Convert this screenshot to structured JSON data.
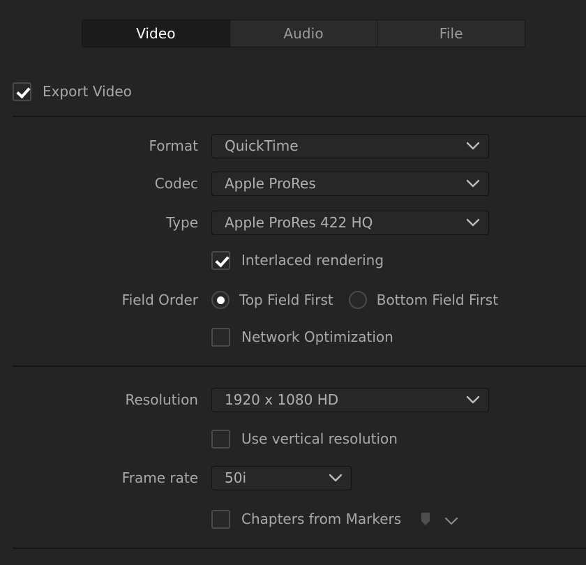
{
  "tabs": [
    {
      "id": "video",
      "label": "Video",
      "active": true
    },
    {
      "id": "audio",
      "label": "Audio",
      "active": false
    },
    {
      "id": "file",
      "label": "File",
      "active": false
    }
  ],
  "export_video": {
    "label": "Export Video",
    "checked": true
  },
  "video_section": {
    "format": {
      "label": "Format",
      "value": "QuickTime"
    },
    "codec": {
      "label": "Codec",
      "value": "Apple ProRes"
    },
    "type": {
      "label": "Type",
      "value": "Apple ProRes 422 HQ"
    },
    "interlaced": {
      "label": "Interlaced rendering",
      "checked": true
    },
    "field_order": {
      "label": "Field Order",
      "options": [
        {
          "label": "Top Field First",
          "selected": true
        },
        {
          "label": "Bottom Field First",
          "selected": false
        }
      ]
    },
    "network_optimization": {
      "label": "Network Optimization",
      "checked": false
    }
  },
  "resolution_section": {
    "resolution": {
      "label": "Resolution",
      "value": "1920 x 1080 HD"
    },
    "use_vertical": {
      "label": "Use vertical resolution",
      "checked": false
    },
    "frame_rate": {
      "label": "Frame rate",
      "value": "50i"
    },
    "chapters": {
      "label": "Chapters from Markers",
      "checked": false
    }
  },
  "icons": {
    "chevron_down": "chevron-down-icon",
    "marker": "marker-flag-icon",
    "checkmark": "check-icon"
  },
  "colors": {
    "background": "#242424",
    "panel_control": "#272727",
    "tab_active": "#1b1b1b",
    "tab_inactive": "#2b2b2b",
    "text": "#a8a8a8",
    "text_active": "#ffffff",
    "separator": "#151515"
  }
}
